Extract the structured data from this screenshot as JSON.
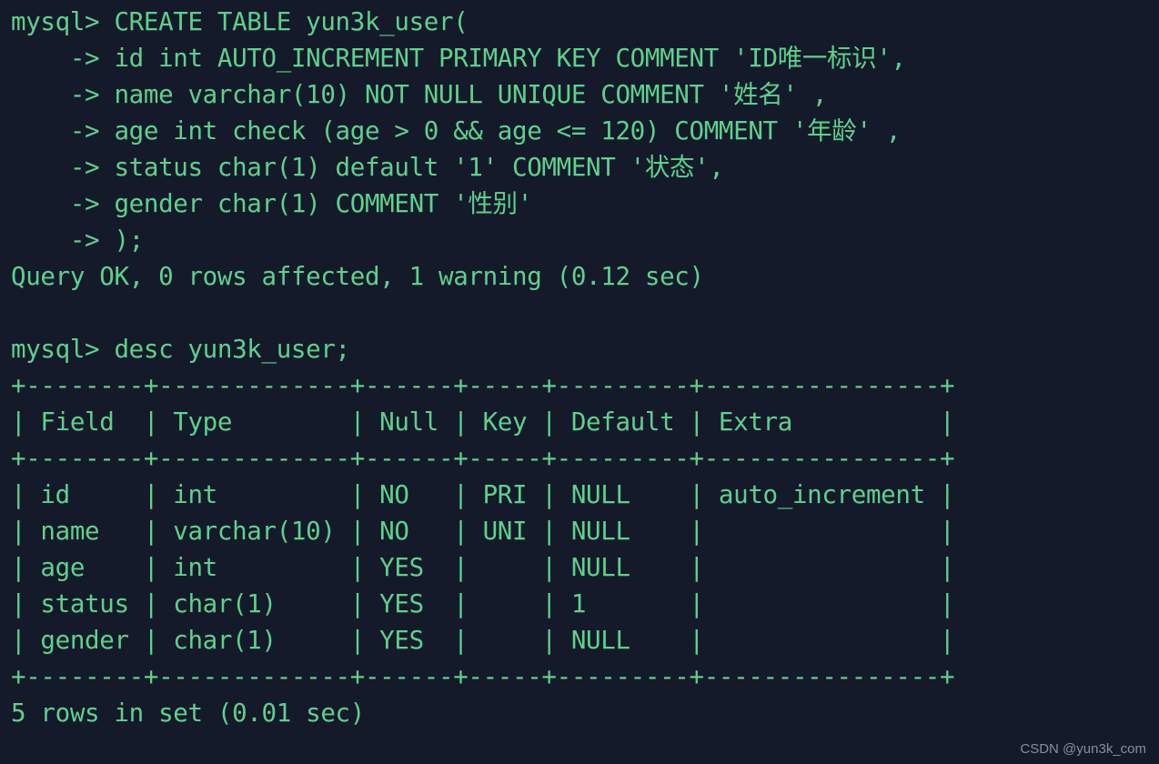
{
  "terminal": {
    "background_color": "#141a2a",
    "text_color": "#5ed18b",
    "prompt": "mysql>",
    "continuation_prompt": "->",
    "lines": [
      "mysql> CREATE TABLE yun3k_user(",
      "    -> id int AUTO_INCREMENT PRIMARY KEY COMMENT 'ID唯一标识',",
      "    -> name varchar(10) NOT NULL UNIQUE COMMENT '姓名' ,",
      "    -> age int check (age > 0 && age <= 120) COMMENT '年龄' ,",
      "    -> status char(1) default '1' COMMENT '状态',",
      "    -> gender char(1) COMMENT '性别'",
      "    -> );",
      "Query OK, 0 rows affected, 1 warning (0.12 sec)",
      "",
      "mysql> desc yun3k_user;",
      "+--------+-------------+------+-----+---------+----------------+",
      "| Field  | Type        | Null | Key | Default | Extra          |",
      "+--------+-------------+------+-----+---------+----------------+",
      "| id     | int         | NO   | PRI | NULL    | auto_increment |",
      "| name   | varchar(10) | NO   | UNI | NULL    |                |",
      "| age    | int         | YES  |     | NULL    |                |",
      "| status | char(1)     | YES  |     | 1       |                |",
      "| gender | char(1)     | YES  |     | NULL    |                |",
      "+--------+-------------+------+-----+---------+----------------+",
      "5 rows in set (0.01 sec)"
    ],
    "statements": {
      "create_table": {
        "command": "CREATE TABLE yun3k_user(",
        "table_name": "yun3k_user",
        "columns": [
          "id int AUTO_INCREMENT PRIMARY KEY COMMENT 'ID唯一标识',",
          "name varchar(10) NOT NULL UNIQUE COMMENT '姓名' ,",
          "age int check (age > 0 && age <= 120) COMMENT '年龄' ,",
          "status char(1) default '1' COMMENT '状态',",
          "gender char(1) COMMENT '性别'"
        ],
        "closing": ");",
        "result": "Query OK, 0 rows affected, 1 warning (0.12 sec)"
      },
      "describe": {
        "command": "desc yun3k_user;",
        "result": "5 rows in set (0.01 sec)"
      }
    },
    "describe_table": {
      "headers": [
        "Field",
        "Type",
        "Null",
        "Key",
        "Default",
        "Extra"
      ],
      "rows": [
        [
          "id",
          "int",
          "NO",
          "PRI",
          "NULL",
          "auto_increment"
        ],
        [
          "name",
          "varchar(10)",
          "NO",
          "UNI",
          "NULL",
          ""
        ],
        [
          "age",
          "int",
          "YES",
          "",
          "NULL",
          ""
        ],
        [
          "status",
          "char(1)",
          "YES",
          "",
          "1",
          ""
        ],
        [
          "gender",
          "char(1)",
          "YES",
          "",
          "NULL",
          ""
        ]
      ]
    }
  },
  "watermark": {
    "text": "CSDN @yun3k_com"
  }
}
